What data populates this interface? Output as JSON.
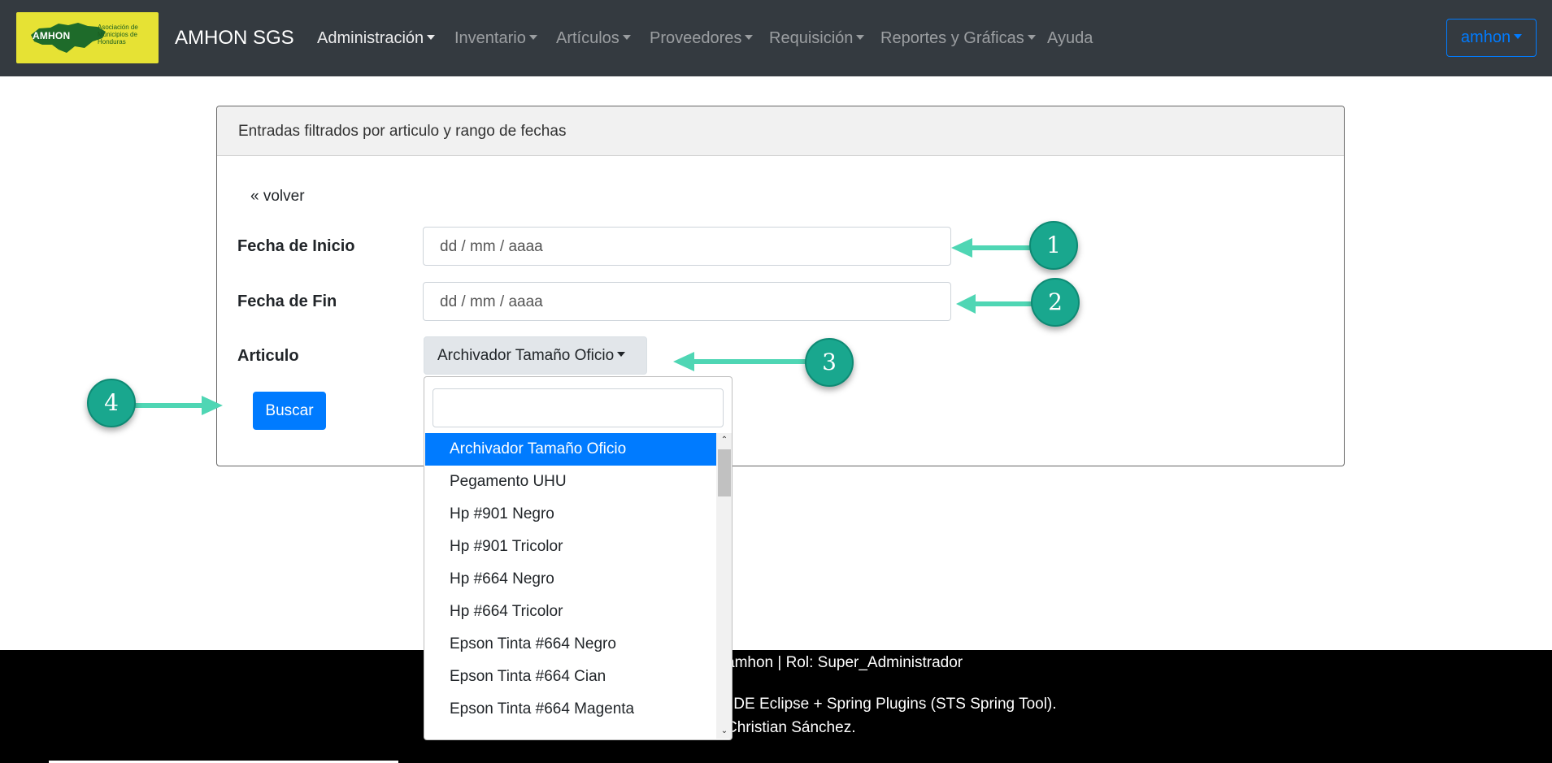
{
  "navbar": {
    "logo": {
      "word": "AMHON",
      "subtitle": "Asociación de Municipios de Honduras"
    },
    "brand": "AMHON SGS",
    "menu": [
      {
        "label": "Administración",
        "has_caret": true
      },
      {
        "label": "Inventario",
        "has_caret": true
      },
      {
        "label": "Artículos",
        "has_caret": true
      },
      {
        "label": "Proveedores",
        "has_caret": true
      },
      {
        "label": "Requisición",
        "has_caret": true
      },
      {
        "label": "Reportes y Gráficas",
        "has_caret": true
      },
      {
        "label": "Ayuda",
        "has_caret": false
      }
    ],
    "user_menu": "amhon"
  },
  "card": {
    "header": "Entradas filtrados por articulo y rango de fechas",
    "back_link": "« volver",
    "fecha_inicio": {
      "label": "Fecha de Inicio",
      "placeholder": "dd / mm / aaaa"
    },
    "fecha_fin": {
      "label": "Fecha de Fin",
      "placeholder": "dd / mm / aaaa"
    },
    "articulo": {
      "label": "Articulo",
      "selected": "Archivador Tamaño Oficio"
    },
    "search_button": "Buscar"
  },
  "dropdown": {
    "search_value": "",
    "items": [
      "Archivador Tamaño Oficio",
      "Pegamento UHU",
      "Hp #901 Negro",
      "Hp #901 Tricolor",
      "Hp #664 Negro",
      "Hp #664 Tricolor",
      "Epson Tinta #664 Negro",
      "Epson Tinta #664 Cian",
      "Epson Tinta #664 Magenta"
    ],
    "selected_index": 0
  },
  "footer": {
    "line1": "amhon | Rol: Super_Administrador",
    "line2": "IDE Eclipse + Spring Plugins (STS Spring Tool).",
    "line3": "Christian Sánchez."
  },
  "callouts": [
    "1",
    "2",
    "3",
    "4"
  ],
  "colors": {
    "navbar_bg": "#343a40",
    "primary": "#007bff",
    "callout": "#19a78e",
    "logo_bg": "#e6e234",
    "footer_bg": "#000000"
  }
}
